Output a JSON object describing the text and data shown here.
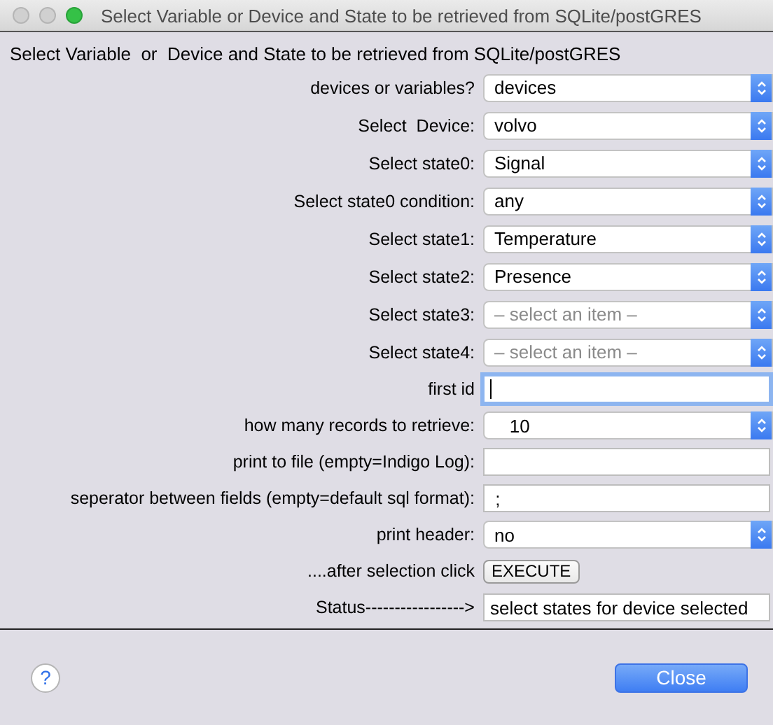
{
  "window": {
    "title": "Select Variable or Device and State to be retrieved from SQLite/postGRES"
  },
  "heading": "Select Variable  or  Device and State to be retrieved from SQLite/postGRES",
  "rows": [
    {
      "kind": "select",
      "label": "devices or variables?",
      "value": "devices"
    },
    {
      "kind": "select",
      "label": "Select  Device:",
      "value": "volvo"
    },
    {
      "kind": "select",
      "label": "Select state0:",
      "value": "Signal"
    },
    {
      "kind": "select",
      "label": "Select state0 condition:",
      "value": "any"
    },
    {
      "kind": "select",
      "label": "Select state1:",
      "value": "Temperature"
    },
    {
      "kind": "select",
      "label": "Select state2:",
      "value": "Presence"
    },
    {
      "kind": "select",
      "label": "Select state3:",
      "placeholder": "– select an item –"
    },
    {
      "kind": "select",
      "label": "Select state4:",
      "placeholder": "– select an item –"
    },
    {
      "kind": "text",
      "label": "first id",
      "focused": true
    },
    {
      "kind": "select",
      "label": "how many records to retrieve:",
      "value": "   10"
    },
    {
      "kind": "text",
      "label": "print to file (empty=Indigo Log):",
      "focused": false
    },
    {
      "kind": "text",
      "label": "seperator between fields (empty=default sql format):",
      "value": " ;",
      "focused": false
    },
    {
      "kind": "select",
      "label": "print header:",
      "value": "no"
    },
    {
      "kind": "button",
      "label": "....after selection click",
      "value": "EXECUTE"
    },
    {
      "kind": "text",
      "label": "Status----------------->",
      "value": "select states for device selected",
      "focused": false
    }
  ],
  "help": "?",
  "buttons": [
    "Close"
  ]
}
